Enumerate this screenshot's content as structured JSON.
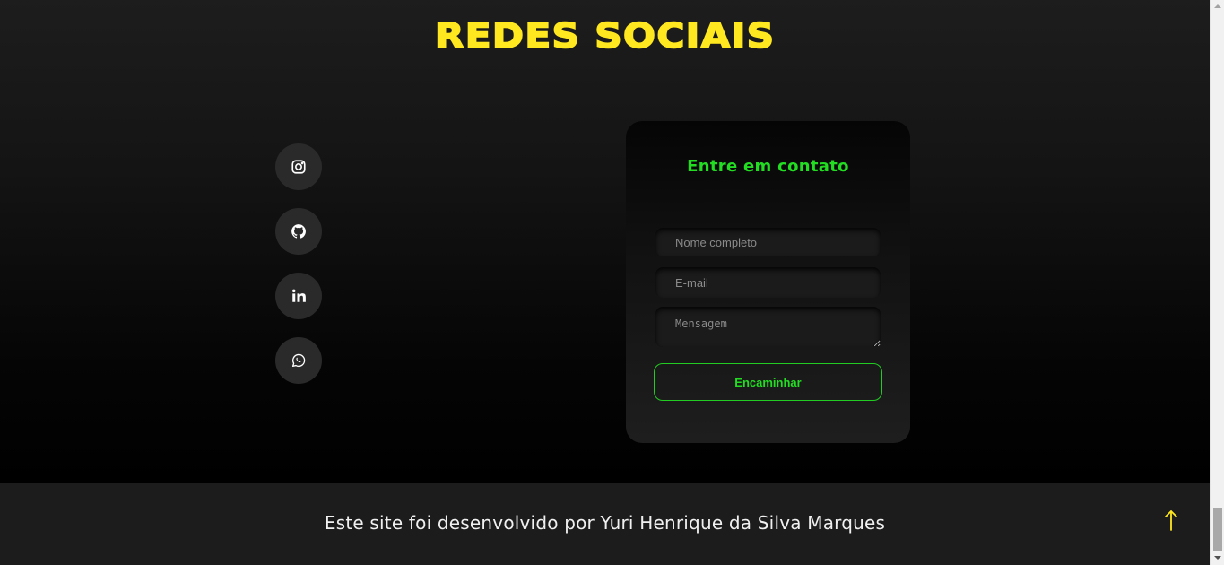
{
  "section": {
    "title": "REDES SOCIAIS"
  },
  "social_links": [
    {
      "name": "instagram",
      "icon": "instagram-icon"
    },
    {
      "name": "github",
      "icon": "github-icon"
    },
    {
      "name": "linkedin",
      "icon": "linkedin-icon"
    },
    {
      "name": "whatsapp",
      "icon": "whatsapp-icon"
    }
  ],
  "contact_form": {
    "title": "Entre em contato",
    "name_placeholder": "Nome completo",
    "email_placeholder": "E-mail",
    "message_placeholder": "Mensagem",
    "submit_label": "Encaminhar"
  },
  "footer": {
    "credit": "Este site foi desenvolvido por Yuri Henrique da Silva Marques",
    "back_to_top_icon": "arrow-up-icon"
  },
  "colors": {
    "title_yellow": "#ffe81f",
    "accent_green": "#22dd22",
    "background": "#000000",
    "footer_bg": "#1c1c1c"
  }
}
